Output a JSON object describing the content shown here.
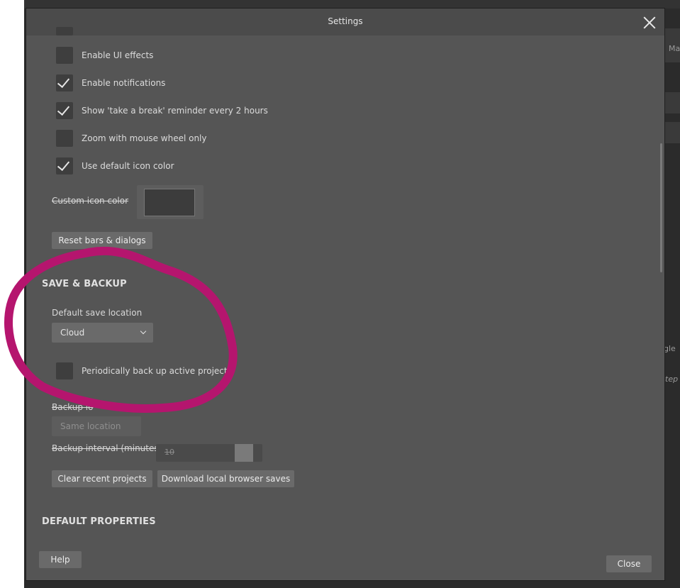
{
  "dialog": {
    "title": "Settings",
    "close_icon": "close-icon"
  },
  "general": {
    "checkboxes": [
      {
        "label": "Enable UI effects",
        "checked": false
      },
      {
        "label": "Enable notifications",
        "checked": true
      },
      {
        "label": "Show 'take a break' reminder every 2 hours",
        "checked": true
      },
      {
        "label": "Zoom with mouse wheel only",
        "checked": false
      },
      {
        "label": "Use default icon color",
        "checked": true
      }
    ],
    "custom_icon_color_label": "Custom icon color",
    "reset_button": "Reset bars & dialogs"
  },
  "save_backup": {
    "title": "SAVE & BACKUP",
    "default_save_location_label": "Default save location",
    "default_save_location_value": "Cloud",
    "periodic_backup_label": "Periodically back up active project",
    "periodic_backup_checked": false,
    "backup_location_label": "Backup lo",
    "backup_location_value": "Same location",
    "backup_interval_label": "Backup interval (minutes)",
    "backup_interval_value": "10",
    "clear_recent_button": "Clear recent projects",
    "download_saves_button": "Download local browser saves"
  },
  "default_properties": {
    "title": "DEFAULT PROPERTIES"
  },
  "footer": {
    "help_button": "Help",
    "close_button": "Close"
  },
  "background_fragments": {
    "a": "Ma",
    "b": "gle",
    "c": "tep"
  },
  "colors": {
    "dialog_bg": "#555555",
    "titlebar_bg": "#4b4b4b",
    "button_bg": "#6a6a6a",
    "checkbox_bg": "#3e3e3e",
    "annotation": "#b5156e"
  }
}
